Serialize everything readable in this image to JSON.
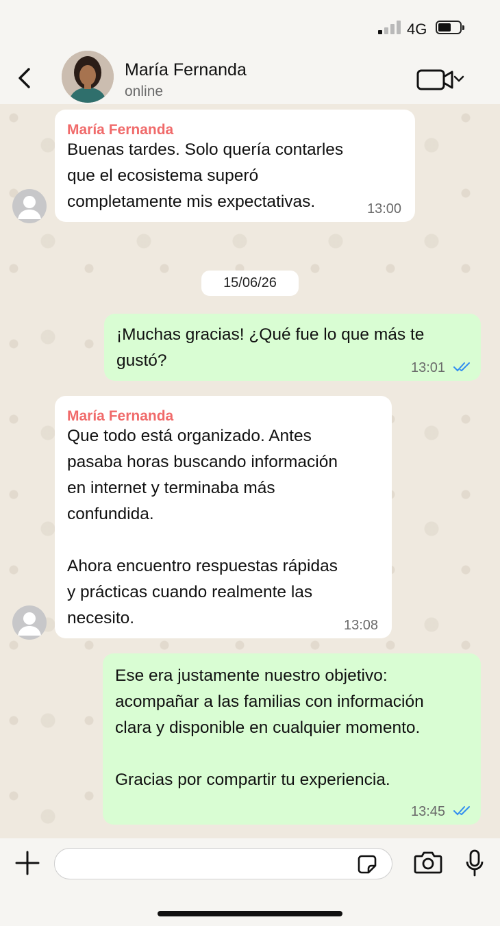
{
  "status_bar": {
    "network": "4G"
  },
  "header": {
    "contact_name": "María Fernanda",
    "contact_status": "online"
  },
  "messages": [
    {
      "direction": "incoming",
      "sender": "María Fernanda",
      "text": "Buenas tardes. Solo quería contarles\nque el ecosistema superó\ncompletamente mis expectativas.",
      "time": "13:00"
    },
    {
      "type": "date",
      "label": "15/06/26"
    },
    {
      "direction": "outgoing",
      "text": "¡Muchas gracias! ¿Qué fue lo que más te\ngustó?",
      "time": "13:01",
      "status": "read"
    },
    {
      "direction": "incoming",
      "sender": "María Fernanda",
      "text": "Que todo está organizado. Antes\npasaba horas buscando información\nen internet y terminaba más\nconfundida.\n\nAhora encuentro respuestas rápidas\ny prácticas cuando realmente las\nnecesito.",
      "time": "13:08"
    },
    {
      "direction": "outgoing",
      "text": "Ese era justamente nuestro objetivo:\nacompañar a las familias con información\nclara y disponible en cualquier momento.\n\nGracias por compartir tu experiencia.",
      "time": "13:45",
      "status": "read"
    }
  ],
  "input": {
    "placeholder": ""
  },
  "colors": {
    "incoming_bubble": "#ffffff",
    "outgoing_bubble": "#d9fdd3",
    "sender_name": "#f06a6a",
    "read_ticks": "#2f8cf0"
  }
}
